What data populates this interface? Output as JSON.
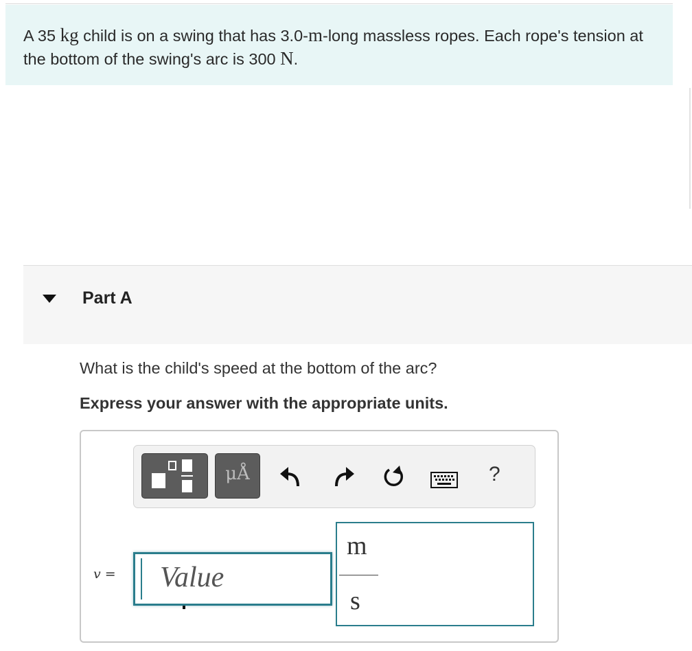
{
  "problem": {
    "parts": [
      {
        "t": "A 35 ",
        "unit": false
      },
      {
        "t": "kg",
        "unit": true
      },
      {
        "t": " child is on a swing that has 3.0-",
        "unit": false
      },
      {
        "t": "m",
        "unit": true
      },
      {
        "t": "-long massless ropes. Each rope's tension at the bottom of the swing's arc is 300 ",
        "unit": false
      },
      {
        "t": "N",
        "unit": true
      },
      {
        "t": ".",
        "unit": false
      }
    ]
  },
  "part": {
    "title": "Part A"
  },
  "question": "What is the child's speed at the bottom of the arc?",
  "instruction": "Express your answer with the appropriate units.",
  "toolbar": {
    "units_label": "μÅ",
    "help_label": "?",
    "icons": [
      "templates-icon",
      "units-icon",
      "undo-icon",
      "redo-icon",
      "reset-icon",
      "keyboard-icon",
      "help-icon"
    ]
  },
  "answer": {
    "variable": "v",
    "equals": "=",
    "value_placeholder": "Value",
    "unit_numerator": "m",
    "unit_denominator": "s"
  }
}
